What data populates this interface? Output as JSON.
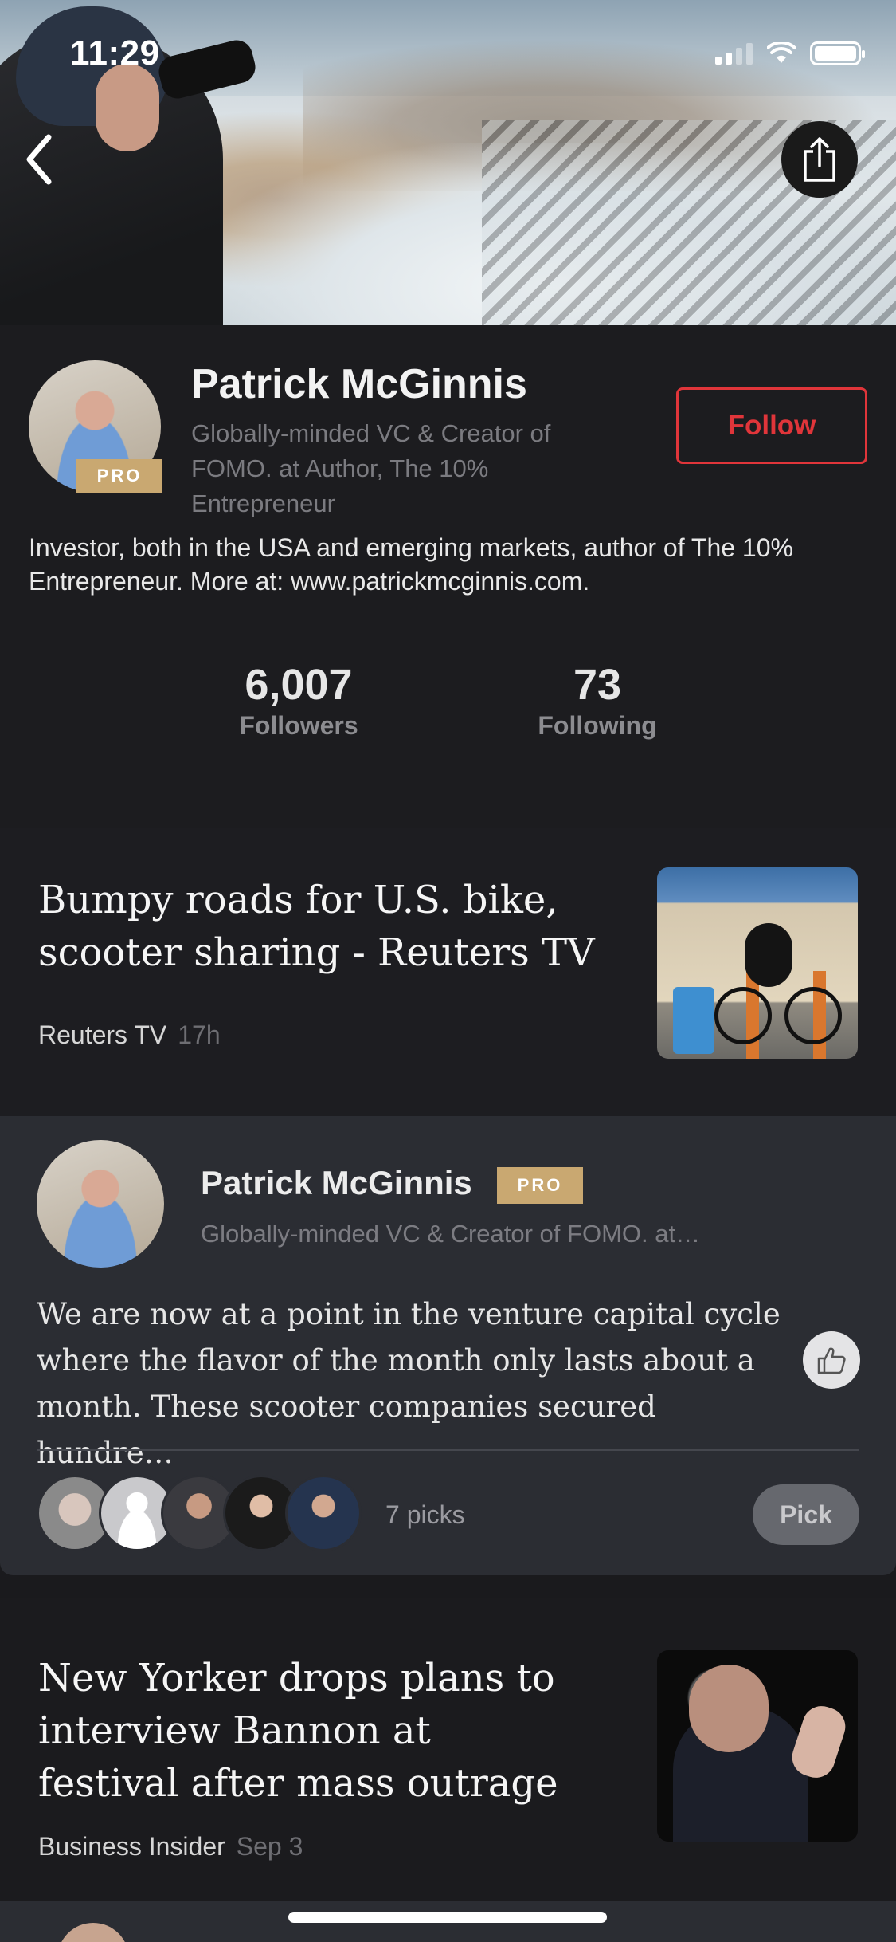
{
  "status_bar": {
    "time": "11:29"
  },
  "header": {
    "back_icon": "chevron-left-icon",
    "share_icon": "share-icon"
  },
  "profile": {
    "name": "Patrick McGinnis",
    "badge": "PRO",
    "tagline": "Globally-minded VC & Creator of FOMO.  at Author, The 10% Entrepreneur",
    "follow_label": "Follow",
    "bio": "Investor, both in the USA and emerging markets, author of The 10% Entrepreneur. More at: www.patrickmcginnis.com.",
    "stats": {
      "followers_count": "6,007",
      "followers_label": "Followers",
      "following_count": "73",
      "following_label": "Following"
    }
  },
  "feed": {
    "article1": {
      "title": "Bumpy roads for U.S. bike, scooter sharing - Reuters TV",
      "source": "Reuters TV",
      "time": "17h"
    },
    "pick_card": {
      "name": "Patrick McGinnis",
      "badge": "PRO",
      "tagline": "Globally-minded VC & Creator of FOMO.  at…",
      "comment": "We are now at a point in the venture capital cycle where the flavor of the month only lasts about a month. These scooter companies secured hundre…",
      "picks_count": "7 picks",
      "pick_label": "Pick"
    },
    "article2": {
      "title": "New Yorker drops plans to interview Bannon at festival after mass outrage",
      "source": "Business Insider",
      "time": "Sep 3"
    }
  },
  "colors": {
    "accent": "#e0353a",
    "pro_badge": "#c9a871",
    "background": "#1c1c1f",
    "card": "#2b2d33"
  }
}
